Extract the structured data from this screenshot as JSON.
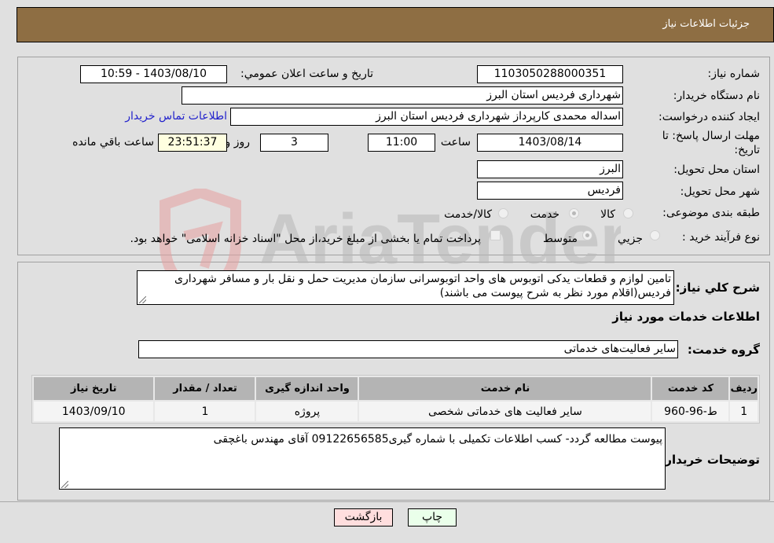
{
  "header": {
    "title": "جزئیات اطلاعات نیاز"
  },
  "details": {
    "need_number_label": "شماره نیاز:",
    "need_number": "1103050288000351",
    "announce_label": "تاریخ و ساعت اعلان عمومي:",
    "announce_value": "1403/08/10 - 10:59",
    "buyer_org_label": "نام دستگاه خریدار:",
    "buyer_org": "شهرداری فردیس استان البرز",
    "creator_label": "ایجاد کننده درخواست:",
    "creator": "اسداله محمدی کارپرداز شهرداری فردیس استان البرز",
    "contact_link": "اطلاعات تماس خریدار",
    "deadline_label_1": "مهلت ارسال پاسخ: تا",
    "deadline_label_2": "تاریخ:",
    "deadline_date": "1403/08/14",
    "time_label": "ساعت",
    "deadline_time": "11:00",
    "days_value": "3",
    "days_label": "روز و",
    "remaining_time": "23:51:37",
    "remaining_label": "ساعت باقي مانده",
    "province_label": "استان محل تحویل:",
    "province": "البرز",
    "city_label": "شهر محل تحویل:",
    "city": "فردیس",
    "category_label": "طبقه بندی موضوعی:",
    "category_options": [
      {
        "label": "کالا",
        "checked": false
      },
      {
        "label": "خدمت",
        "checked": true
      },
      {
        "label": "کالا/خدمت",
        "checked": false
      }
    ],
    "process_label": "نوع فرآیند خرید :",
    "process_options": [
      {
        "label": "جزيي",
        "checked": false
      },
      {
        "label": "متوسط",
        "checked": true
      }
    ],
    "treasury_checkbox_checked": false,
    "treasury_text": "پرداخت تمام یا بخشی از مبلغ خرید،از محل \"اسناد خزانه اسلامی\" خواهد بود."
  },
  "description": {
    "label": "شرح کلي نیاز:",
    "text": "تامین لوازم و قطعات یدکی اتوبوس های واحد اتوبوسرانی سازمان مدیریت حمل و نقل بار و مسافر شهرداری فردیس(اقلام مورد نظر به شرح پیوست می باشند)"
  },
  "services": {
    "section_title": "اطلاعات خدمات مورد نیاز",
    "group_label": "گروه خدمت:",
    "group_value": "سایر فعالیت‌های خدماتی",
    "columns": [
      "ردیف",
      "کد خدمت",
      "نام خدمت",
      "واحد اندازه گیری",
      "تعداد / مقدار",
      "تاریخ نیاز"
    ],
    "rows": [
      [
        "1",
        "ط-96-960",
        "سایر فعالیت های خدماتی شخصی",
        "پروژه",
        "1",
        "1403/09/10"
      ]
    ]
  },
  "buyer_notes": {
    "label": "توضیحات خریدار:",
    "text": "پیوست مطالعه گردد- کسب اطلاعات تکمیلی با شماره گیری09122656585 آقای مهندس باغچقی"
  },
  "buttons": {
    "print": "چاپ",
    "back": "بازگشت"
  },
  "watermark": {
    "text": "AriaTender.neT"
  },
  "colors": {
    "header_bg": "#8e6e43",
    "link": "#2222cc",
    "print_bg": "#eaffea",
    "back_bg": "#ffdede",
    "remaining_bg": "#ffffe0"
  }
}
